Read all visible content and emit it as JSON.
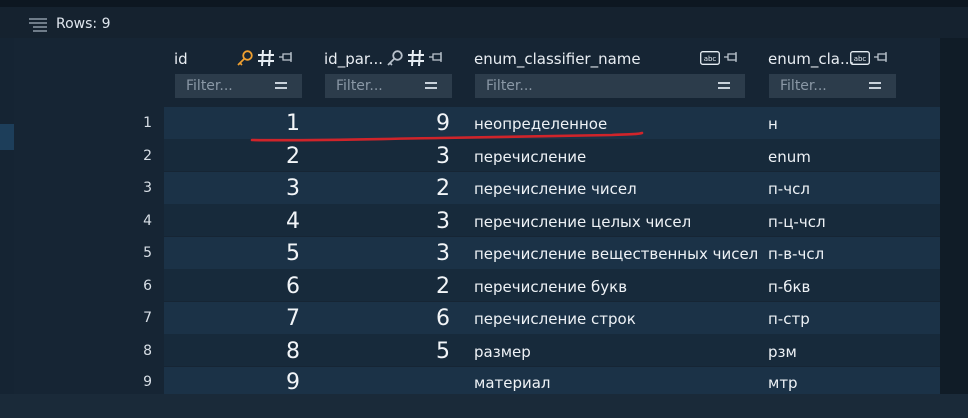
{
  "toolbar": {
    "rows_label": "Rows: 9"
  },
  "columns": [
    {
      "name": "id",
      "icons": [
        "key-icon",
        "hash-icon",
        "pin-icon"
      ],
      "filter_placeholder": "Filter..."
    },
    {
      "name": "id_par...",
      "icons": [
        "key-icon",
        "hash-icon",
        "pin-icon"
      ],
      "filter_placeholder": "Filter..."
    },
    {
      "name": "enum_classifier_name",
      "icons": [
        "abc-icon",
        "pin-icon"
      ],
      "filter_placeholder": "Filter..."
    },
    {
      "name": "enum_cla...",
      "icons": [
        "abc-icon",
        "pin-icon"
      ],
      "filter_placeholder": "Filter..."
    }
  ],
  "rows": [
    {
      "n": "1",
      "id": "1",
      "id_parent": "9",
      "name": "неопределенное",
      "short": "н"
    },
    {
      "n": "2",
      "id": "2",
      "id_parent": "3",
      "name": "перечисление",
      "short": "enum"
    },
    {
      "n": "3",
      "id": "3",
      "id_parent": "2",
      "name": "перечисление чисел",
      "short": "п-чсл"
    },
    {
      "n": "4",
      "id": "4",
      "id_parent": "3",
      "name": "перечисление целых чисел",
      "short": "п-ц-чсл"
    },
    {
      "n": "5",
      "id": "5",
      "id_parent": "3",
      "name": "перечисление вещественных чисел",
      "short": "п-в-чсл"
    },
    {
      "n": "6",
      "id": "6",
      "id_parent": "2",
      "name": "перечисление букв",
      "short": "п-бкв"
    },
    {
      "n": "7",
      "id": "7",
      "id_parent": "6",
      "name": "перечисление строк",
      "short": "п-стр"
    },
    {
      "n": "8",
      "id": "8",
      "id_parent": "5",
      "name": "размер",
      "short": "рзм"
    },
    {
      "n": "9",
      "id": "9",
      "id_parent": "",
      "name": "материал",
      "short": "мтр"
    }
  ],
  "colors": {
    "key_primary": "#f0a030",
    "key_secondary": "#b9c2cc",
    "annotation": "#d0242a"
  }
}
